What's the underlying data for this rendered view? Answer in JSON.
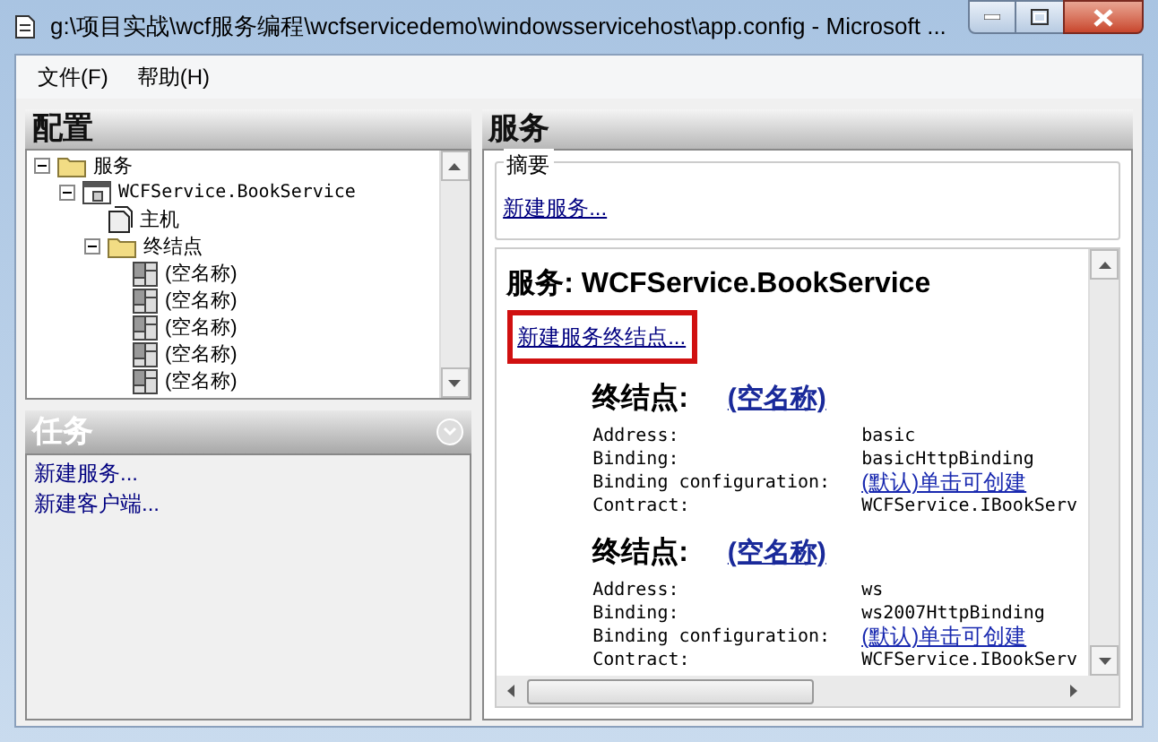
{
  "window": {
    "title": "g:\\项目实战\\wcf服务编程\\wcfservicedemo\\windowsservicehost\\app.config - Microsoft ..."
  },
  "menu": [
    "文件(F)",
    "帮助(H)"
  ],
  "config_panel": {
    "title": "配置",
    "tree": [
      {
        "label": "服务",
        "kind": "folder",
        "expanded": true,
        "children": [
          {
            "label": "WCFService.BookService",
            "kind": "service",
            "expanded": true,
            "children": [
              {
                "label": "主机",
                "kind": "document"
              },
              {
                "label": "终结点",
                "kind": "folder",
                "expanded": true,
                "children": [
                  {
                    "label": "(空名称)",
                    "kind": "endpoint"
                  },
                  {
                    "label": "(空名称)",
                    "kind": "endpoint"
                  },
                  {
                    "label": "(空名称)",
                    "kind": "endpoint"
                  },
                  {
                    "label": "(空名称)",
                    "kind": "endpoint"
                  },
                  {
                    "label": "(空名称)",
                    "kind": "endpoint"
                  }
                ]
              }
            ]
          }
        ]
      }
    ]
  },
  "tasks_panel": {
    "title": "任务",
    "items": [
      "新建服务...",
      "新建客户端..."
    ]
  },
  "service_panel": {
    "title": "服务",
    "summary": {
      "label": "摘要",
      "link": "新建服务..."
    },
    "heading": "服务: WCFService.BookService",
    "new_endpoint_link": "新建服务终结点...",
    "endpoints": [
      {
        "label": "终结点:",
        "name": "(空名称)",
        "fields": [
          {
            "key": "Address:",
            "value": "basic",
            "kind": "text"
          },
          {
            "key": "Binding:",
            "value": "basicHttpBinding",
            "kind": "text"
          },
          {
            "key": "Binding configuration:",
            "value": "(默认)单击可创建",
            "kind": "link"
          },
          {
            "key": "Contract:",
            "value": "WCFService.IBookServ",
            "kind": "text"
          }
        ]
      },
      {
        "label": "终结点:",
        "name": "(空名称)",
        "fields": [
          {
            "key": "Address:",
            "value": "ws",
            "kind": "text"
          },
          {
            "key": "Binding:",
            "value": "ws2007HttpBinding",
            "kind": "text"
          },
          {
            "key": "Binding configuration:",
            "value": "(默认)单击可创建",
            "kind": "link"
          },
          {
            "key": "Contract:",
            "value": "WCFService.IBookServ",
            "kind": "text"
          }
        ]
      }
    ]
  }
}
